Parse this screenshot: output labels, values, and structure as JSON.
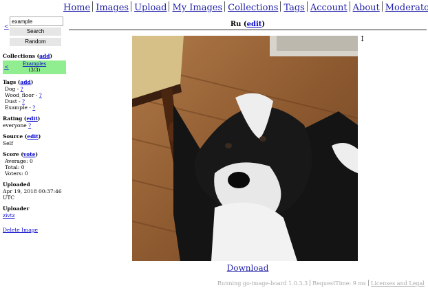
{
  "nav": [
    "Home",
    "Images",
    "Upload",
    "My Images",
    "Collections",
    "Tags",
    "Account",
    "About",
    "Moderator"
  ],
  "search": {
    "value": "example",
    "search_label": "Search",
    "random_label": "Random",
    "back": "<"
  },
  "collections": {
    "title": "Collections",
    "action": "add",
    "back": "<",
    "name": "Examples",
    "count": "(3/3)"
  },
  "tags": {
    "title": "Tags",
    "action": "add",
    "items": [
      {
        "name": "Dog",
        "q": "?"
      },
      {
        "name": "Wood_floor",
        "q": "?"
      },
      {
        "name": "Dust",
        "q": "?"
      },
      {
        "name": "Example",
        "q": "?"
      }
    ]
  },
  "rating": {
    "title": "Rating",
    "action": "edit",
    "value": "everyone",
    "q": "?"
  },
  "source": {
    "title": "Source",
    "action": "edit",
    "value": "Self"
  },
  "score": {
    "title": "Score",
    "action": "vote",
    "average": "Average: 0",
    "total": "Total: 0",
    "voters": "Voters: 0"
  },
  "uploaded": {
    "title": "Uploaded",
    "value": "Apr 19, 2018 00:37:46 UTC"
  },
  "uploader": {
    "title": "Uploader",
    "value": "zivtz"
  },
  "delete_label": "Delete Image",
  "image": {
    "name": "Ru",
    "action": "edit",
    "download": "Download",
    "resize_icon": "resize-vertical-icon"
  },
  "footer": {
    "running": "Running go-image-board 1.0.3.3",
    "request": "RequestTime: 9 ms",
    "licenses": "Licenses and Legal"
  }
}
